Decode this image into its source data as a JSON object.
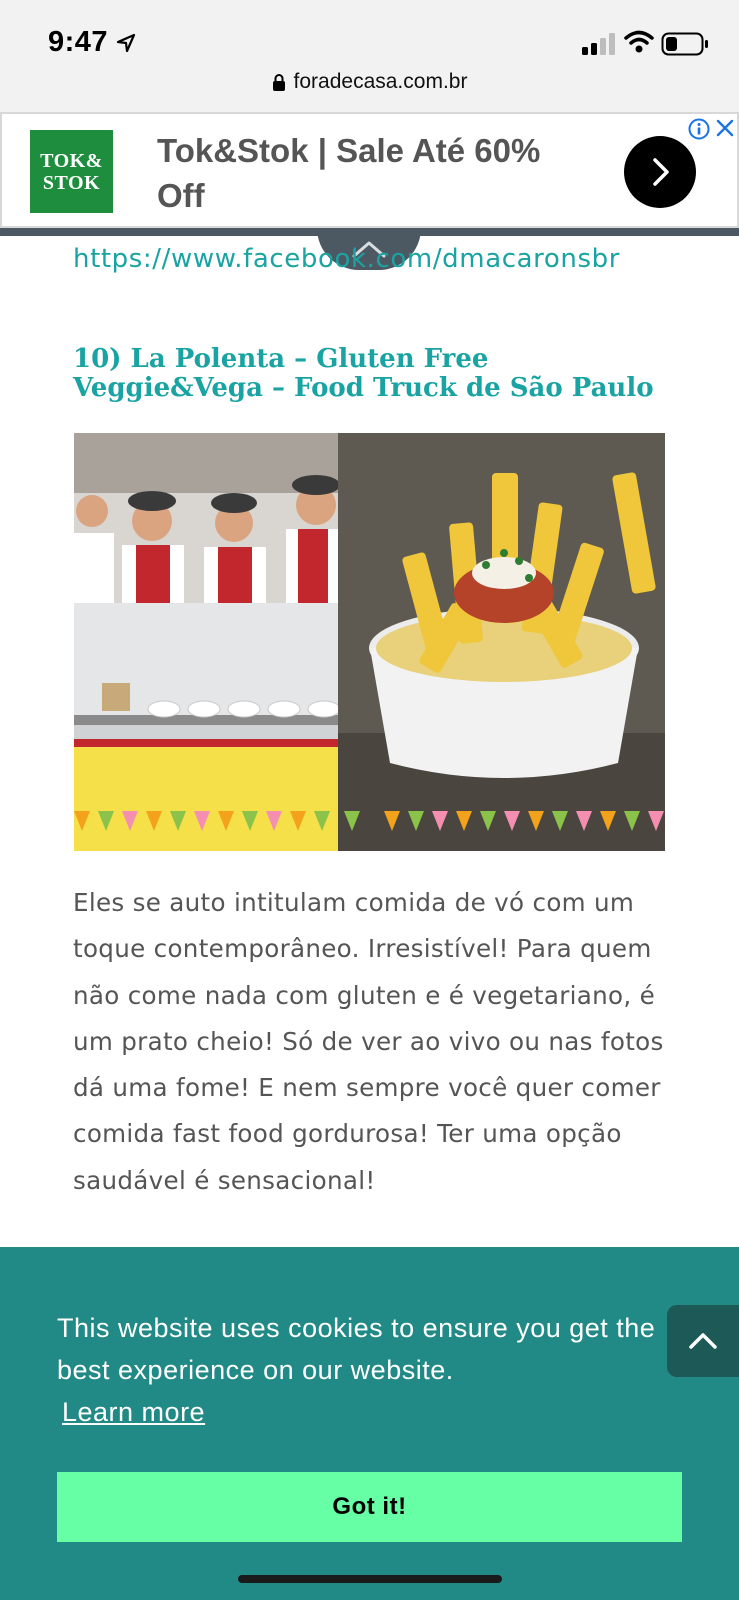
{
  "status_bar": {
    "time": "9:47",
    "icons": [
      "location-arrow-icon",
      "cellular-signal-icon",
      "wifi-icon",
      "battery-icon"
    ]
  },
  "browser": {
    "url": "foradecasa.com.br",
    "lock_icon": "lock-icon"
  },
  "ad": {
    "logo_line1": "TOK&",
    "logo_line2": "STOK",
    "title": "Tok&Stok | Sale Até 60% Off",
    "cta_icon": "chevron-right-icon",
    "info_icon": "info-icon",
    "close_icon": "close-icon",
    "collapse_icon": "chevron-up-icon",
    "colors": {
      "logo_bg": "#1e8e3e",
      "tab": "#4d5962"
    }
  },
  "article": {
    "link": "https://www.facebook.com/dmacaronsbr",
    "heading": "10) La Polenta – Gluten Free Veggie&Vega – Food Truck de São Paulo",
    "body": "Eles se auto intitulam comida de vó com um toque contemporâneo. Irresistível! Para quem não come nada com gluten e é vegetariano, é um prato cheio! Só de ver ao vivo ou nas fotos dá uma fome! E nem sempre você quer comer comida fast food gordurosa! Ter uma opção saudável é sensacional!",
    "accent_color": "#1aa3a3"
  },
  "cookie_banner": {
    "message": "This website uses cookies to ensure you get the best experience on our website.",
    "learn_more": "Learn more",
    "button": "Got it!",
    "colors": {
      "background": "#218a86",
      "button": "#66ffa6"
    }
  },
  "scroll_top_icon": "chevron-up-icon"
}
